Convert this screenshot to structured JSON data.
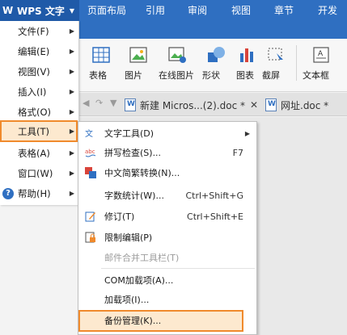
{
  "app": {
    "title": "WPS 文字",
    "logo": "wps-logo-icon"
  },
  "menubar": [
    "页面布局",
    "引用",
    "审阅",
    "视图",
    "章节",
    "开发工"
  ],
  "ribbon": [
    {
      "label": "表格",
      "icon": "table-icon"
    },
    {
      "label": "图片",
      "icon": "picture-icon"
    },
    {
      "label": "在线图片",
      "icon": "online-picture-icon"
    },
    {
      "label": "形状",
      "icon": "shape-icon"
    },
    {
      "label": "图表",
      "icon": "chart-icon"
    },
    {
      "label": "截屏",
      "icon": "screenshot-icon"
    },
    {
      "label": "文本框",
      "icon": "textbox-icon"
    }
  ],
  "tabs": [
    {
      "label": "新建 Micros...(2).doc *"
    },
    {
      "label": "网址.doc *"
    }
  ],
  "left_menu": [
    {
      "label": "文件(F)"
    },
    {
      "label": "编辑(E)"
    },
    {
      "label": "视图(V)"
    },
    {
      "label": "插入(I)"
    },
    {
      "label": "格式(O)"
    },
    {
      "label": "工具(T)"
    },
    {
      "label": "表格(A)"
    },
    {
      "label": "窗口(W)"
    },
    {
      "label": "帮助(H)"
    }
  ],
  "tools_menu": [
    {
      "label": "文字工具(D)",
      "shortcut": "",
      "icon": "text-tools-icon"
    },
    {
      "label": "拼写检查(S)...",
      "shortcut": "F7",
      "icon": "spell-check-icon"
    },
    {
      "label": "中文简繁转换(N)...",
      "shortcut": "",
      "icon": "chinese-convert-icon"
    },
    {
      "label": "字数统计(W)...",
      "shortcut": "Ctrl+Shift+G",
      "icon": ""
    },
    {
      "label": "修订(T)",
      "shortcut": "Ctrl+Shift+E",
      "icon": "revision-icon"
    },
    {
      "label": "限制编辑(P)",
      "shortcut": "",
      "icon": "restrict-edit-icon"
    },
    {
      "label": "邮件合并工具栏(T)",
      "shortcut": "",
      "icon": ""
    },
    {
      "label": "COM加载项(A)...",
      "shortcut": "",
      "icon": ""
    },
    {
      "label": "加载项(I)...",
      "shortcut": "",
      "icon": ""
    },
    {
      "label": "备份管理(K)...",
      "shortcut": "",
      "icon": ""
    }
  ],
  "colors": {
    "titlebar": "#2f6fc1",
    "highlight_border": "#f08a2c",
    "highlight_fill": "#fde9cf"
  }
}
